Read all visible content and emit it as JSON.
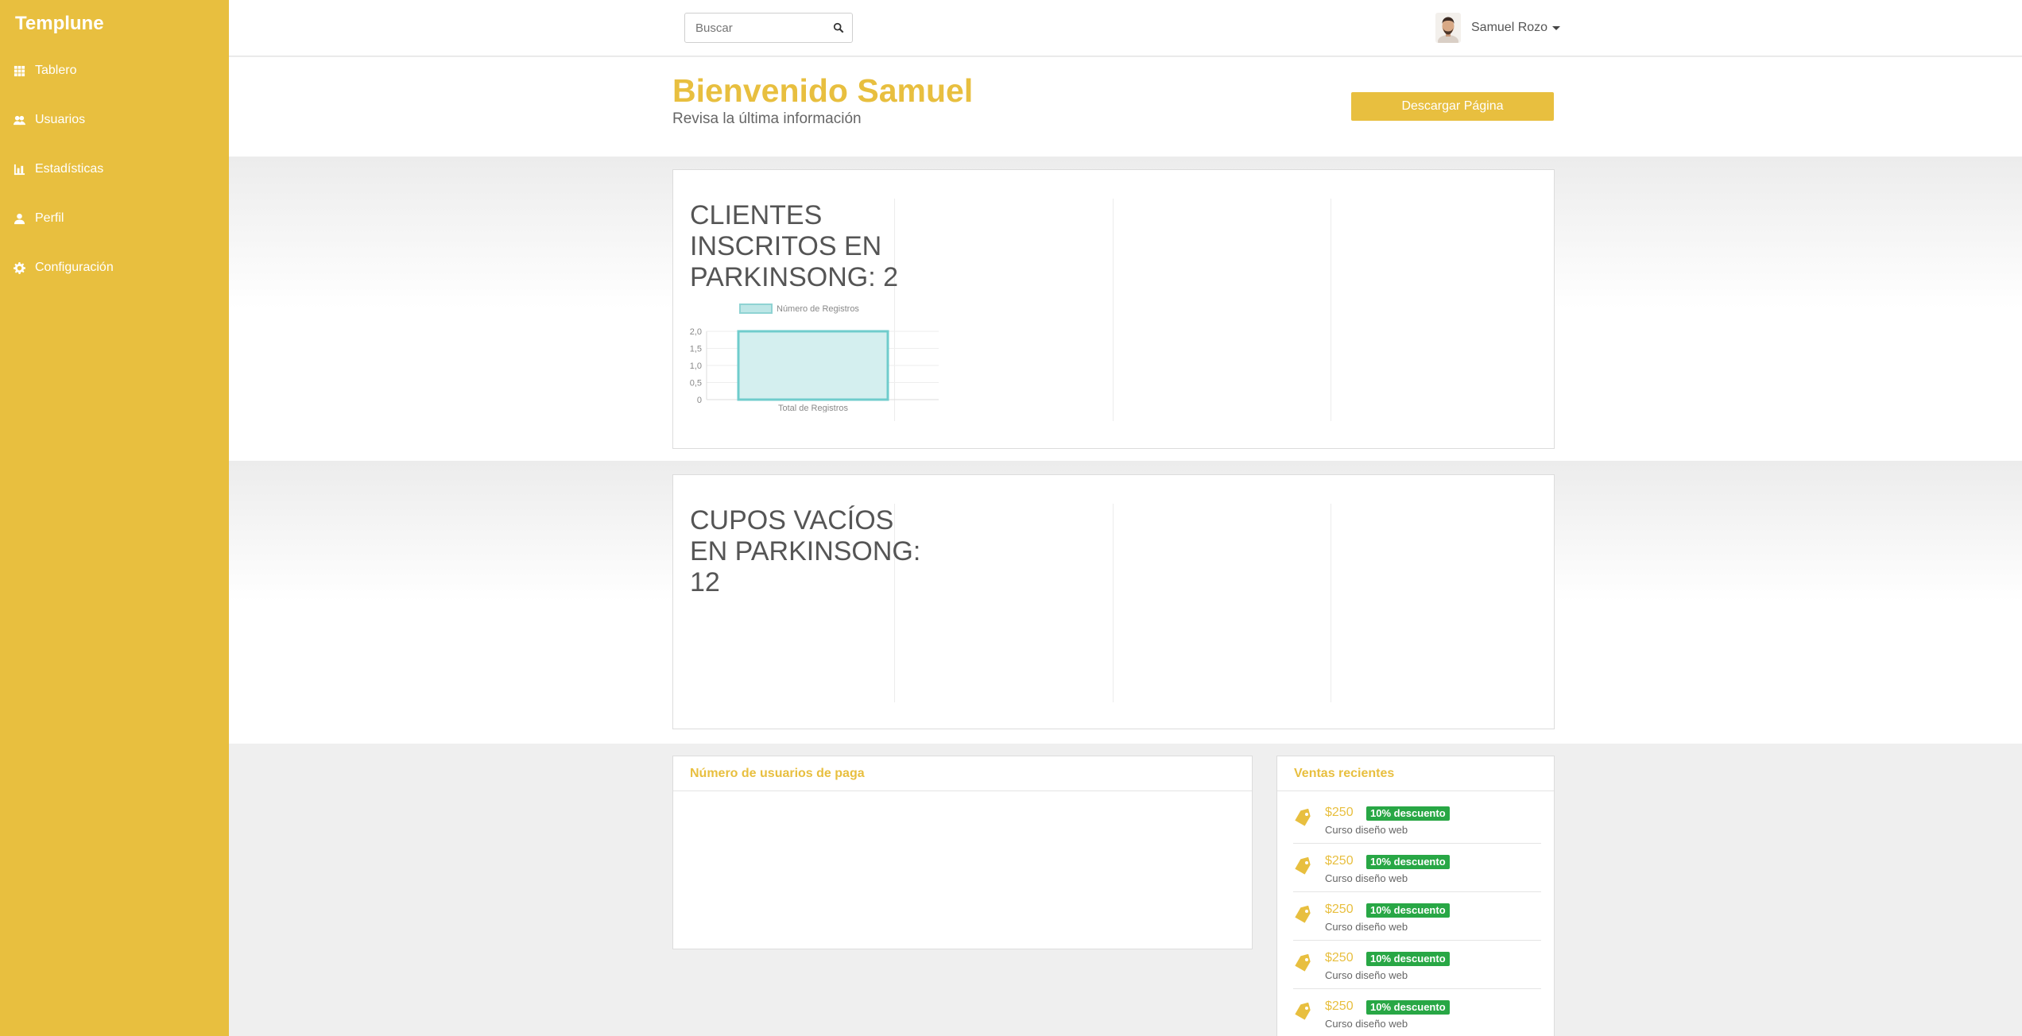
{
  "brand": "Templune",
  "sidebar": {
    "items": [
      {
        "label": "Tablero",
        "icon": "grid-icon"
      },
      {
        "label": "Usuarios",
        "icon": "users-icon"
      },
      {
        "label": "Estadísticas",
        "icon": "bar-chart-icon"
      },
      {
        "label": "Perfil",
        "icon": "user-icon"
      },
      {
        "label": "Configuración",
        "icon": "gear-icon"
      }
    ]
  },
  "topbar": {
    "search_placeholder": "Buscar",
    "user_name": "Samuel Rozo"
  },
  "hero": {
    "title": "Bienvenido Samuel",
    "subtitle": "Revisa la última información",
    "download_label": "Descargar Página"
  },
  "stats": {
    "clients_title": "CLIENTES INSCRITOS EN PARKINSONG: 2",
    "empty_title": "CUPOS VACÍOS EN PARKINSONG: 12"
  },
  "chart_data": {
    "type": "bar",
    "categories": [
      "Total de Registros"
    ],
    "series": [
      {
        "name": "Número de Registros",
        "values": [
          2
        ]
      }
    ],
    "ylim": [
      0,
      2
    ],
    "yticks": [
      "2,0",
      "1,5",
      "1,0",
      "0,5",
      "0"
    ],
    "legend": "top",
    "color": "#4bc0c0"
  },
  "panels": {
    "users_title": "Número de usuarios de paga",
    "sales_title": "Ventas recientes",
    "sales": [
      {
        "price": "$250",
        "badge": "10% descuento",
        "desc": "Curso diseño web"
      },
      {
        "price": "$250",
        "badge": "10% descuento",
        "desc": "Curso diseño web"
      },
      {
        "price": "$250",
        "badge": "10% descuento",
        "desc": "Curso diseño web"
      },
      {
        "price": "$250",
        "badge": "10% descuento",
        "desc": "Curso diseño web"
      },
      {
        "price": "$250",
        "badge": "10% descuento",
        "desc": "Curso diseño web"
      }
    ]
  },
  "colors": {
    "accent": "#e8bf3f",
    "badge": "#28a745"
  }
}
